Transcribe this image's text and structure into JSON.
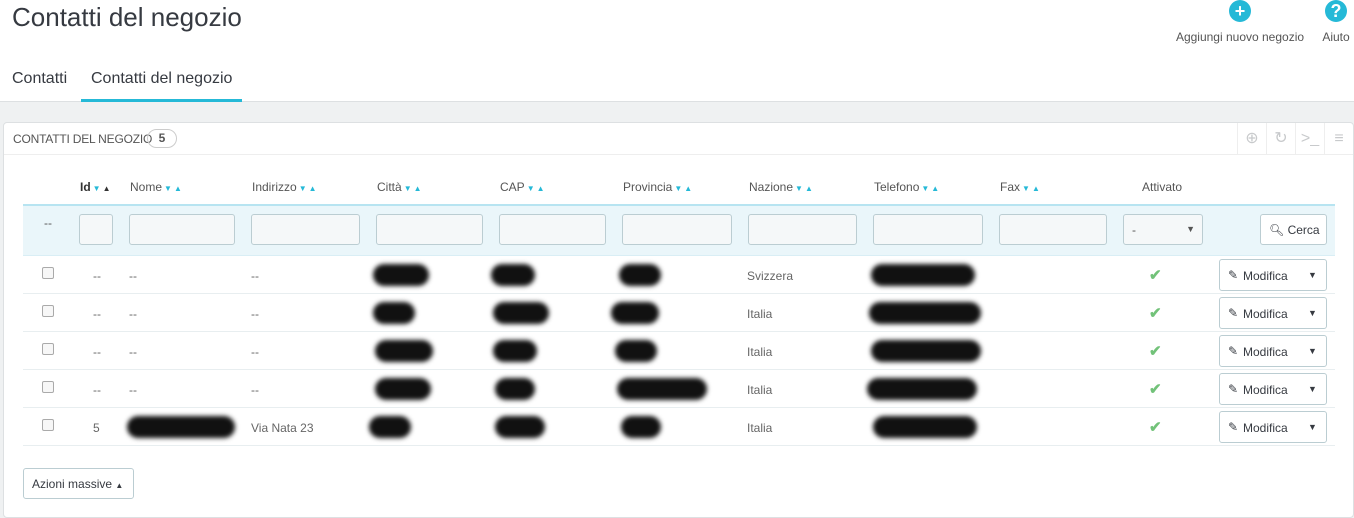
{
  "page_title": "Contatti del negozio",
  "toolbar": {
    "add_label": "Aggiungi nuovo negozio",
    "help_label": "Aiuto"
  },
  "tabs": [
    {
      "label": "Contatti",
      "active": false
    },
    {
      "label": "Contatti del negozio",
      "active": true
    }
  ],
  "panel": {
    "title": "CONTATTI DEL NEGOZIO",
    "count": "5"
  },
  "columns": [
    "Id",
    "Nome",
    "Indirizzo",
    "Città",
    "CAP",
    "Provincia",
    "Nazione",
    "Telefono",
    "Fax",
    "Attivato"
  ],
  "filter": {
    "id_placeholder": "--",
    "active_select": "-",
    "search_label": "Cerca"
  },
  "rows": [
    {
      "id": "--",
      "name": "--",
      "address": "--",
      "country": "Svizzera",
      "active": true,
      "action": "Modifica"
    },
    {
      "id": "--",
      "name": "--",
      "address": "--",
      "country": "Italia",
      "active": true,
      "action": "Modifica"
    },
    {
      "id": "--",
      "name": "--",
      "address": "--",
      "country": "Italia",
      "active": true,
      "action": "Modifica"
    },
    {
      "id": "--",
      "name": "--",
      "address": "--",
      "country": "Italia",
      "active": true,
      "action": "Modifica"
    },
    {
      "id": "5",
      "name": "",
      "address": "Via Nata 23",
      "country": "Italia",
      "active": true,
      "action": "Modifica"
    }
  ],
  "bulk_label": "Azioni massive",
  "colors": {
    "accent": "#25b9d7",
    "check": "#72c279"
  }
}
